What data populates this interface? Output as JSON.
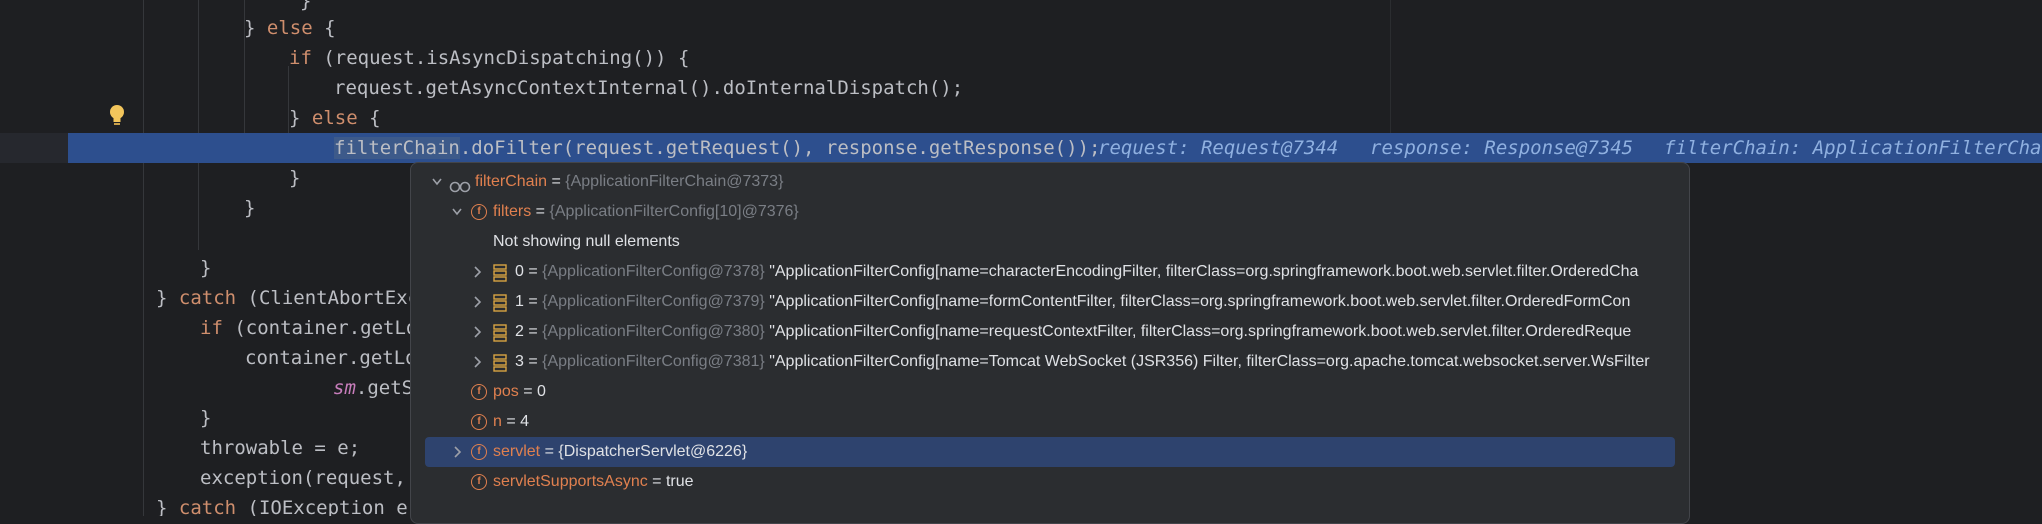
{
  "code": {
    "line0": "}",
    "line1_a": "} ",
    "line1_b": "else",
    "line1_c": " {",
    "line2_a": "if",
    "line2_b": " (request.isAsyncDispatching()) {",
    "line3": "request.getAsyncContextInternal().doInternalDispatch();",
    "line4_a": "} ",
    "line4_b": "else",
    "line4_c": " {",
    "line5_sel": "filterChain",
    "line5_rest": ".doFilter(request.getRequest(), response.getResponse());",
    "hint1": "request: Request@7344",
    "hint2": "response: Response@7345",
    "hint3": "filterChain: ApplicationFilterChai",
    "line6": "}",
    "line7": "}",
    "line8": "}",
    "line9_a": "} ",
    "line9_b": "catch",
    "line9_c": " (ClientAbortExc",
    "line10_a": "if",
    "line10_b": " (container.getLo",
    "line11": "container.getLo",
    "line12_a": "sm",
    "line12_b": ".getS",
    "line13": "}",
    "line14": "throwable = e;",
    "line15": "exception(request,",
    "line16_a": "} ",
    "line16_b": "catch",
    "line16_c": " (IOException e)"
  },
  "popup": {
    "root": {
      "name": "filterChain",
      "eq": " = ",
      "value": "{ApplicationFilterChain@7373}"
    },
    "filters": {
      "name": "filters",
      "eq": " = ",
      "value": "{ApplicationFilterConfig[10]@7376}"
    },
    "null_note": "Not showing null elements",
    "items": [
      {
        "index": "0",
        "eq": " = ",
        "ref": "{ApplicationFilterConfig@7378}",
        "text": " \"ApplicationFilterConfig[name=characterEncodingFilter, filterClass=org.springframework.boot.web.servlet.filter.OrderedCha"
      },
      {
        "index": "1",
        "eq": " = ",
        "ref": "{ApplicationFilterConfig@7379}",
        "text": " \"ApplicationFilterConfig[name=formContentFilter, filterClass=org.springframework.boot.web.servlet.filter.OrderedFormCon"
      },
      {
        "index": "2",
        "eq": " = ",
        "ref": "{ApplicationFilterConfig@7380}",
        "text": " \"ApplicationFilterConfig[name=requestContextFilter, filterClass=org.springframework.boot.web.servlet.filter.OrderedReque"
      },
      {
        "index": "3",
        "eq": " = ",
        "ref": "{ApplicationFilterConfig@7381}",
        "text": " \"ApplicationFilterConfig[name=Tomcat WebSocket (JSR356) Filter, filterClass=org.apache.tomcat.websocket.server.WsFilter"
      }
    ],
    "pos": {
      "name": "pos",
      "eq": " = ",
      "value": "0"
    },
    "n": {
      "name": "n",
      "eq": " = ",
      "value": "4"
    },
    "servlet": {
      "name": "servlet",
      "eq": " = ",
      "value": "{DispatcherServlet@6226}"
    },
    "servletSupportsAsync": {
      "name": "servletSupportsAsync",
      "eq": " = ",
      "value": "true"
    }
  },
  "colors": {
    "editor_bg": "#1e1f22",
    "keyword": "#cf8e6d",
    "execution_line": "#2d4f8e",
    "field_orange": "#e0804f",
    "popup_bg": "#2b2d30",
    "selected_row": "#2e436e"
  },
  "icons": [
    "bulb-icon",
    "watch-glasses-icon",
    "field-icon",
    "array-icon",
    "chevron-down-icon",
    "chevron-right-icon"
  ]
}
